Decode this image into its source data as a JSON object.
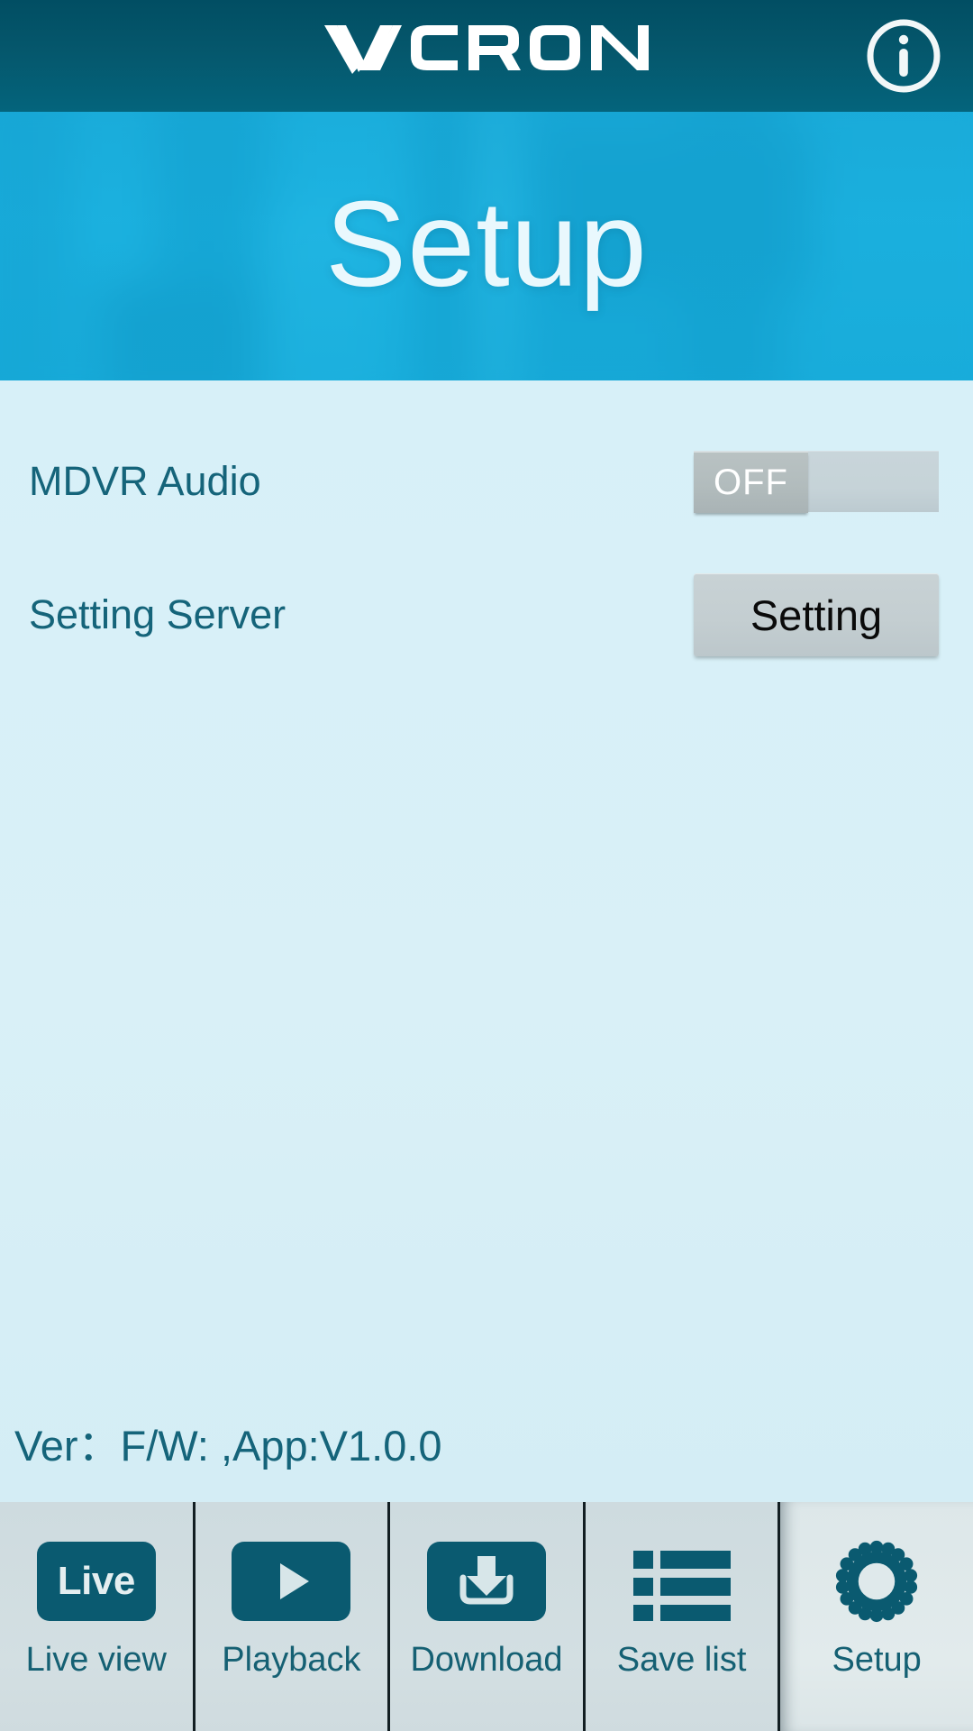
{
  "header": {
    "brand": "VACRON",
    "info_icon": "info-circle-icon"
  },
  "banner": {
    "title": "Setup"
  },
  "settings": {
    "rows": [
      {
        "label": "MDVR Audio",
        "control": "toggle",
        "value": "OFF"
      },
      {
        "label": "Setting Server",
        "control": "button",
        "value": "Setting"
      }
    ]
  },
  "version": {
    "text": "Ver：F/W: ,App:V1.0.0"
  },
  "bottom_nav": {
    "items": [
      {
        "label": "Live view",
        "icon": "live-badge-icon",
        "active": false
      },
      {
        "label": "Playback",
        "icon": "play-icon",
        "active": false
      },
      {
        "label": "Download",
        "icon": "download-tray-icon",
        "active": false
      },
      {
        "label": "Save list",
        "icon": "list-icon",
        "active": false
      },
      {
        "label": "Setup",
        "icon": "gear-icon",
        "active": true
      }
    ]
  },
  "colors": {
    "header_bg": "#04566b",
    "banner_bg": "#17aedd",
    "content_bg": "#d8f0f7",
    "label_text": "#15647a",
    "nav_bg": "#cfdce0",
    "nav_icon": "#0a5a70",
    "nav_active_bg": "#dfe9eb"
  }
}
